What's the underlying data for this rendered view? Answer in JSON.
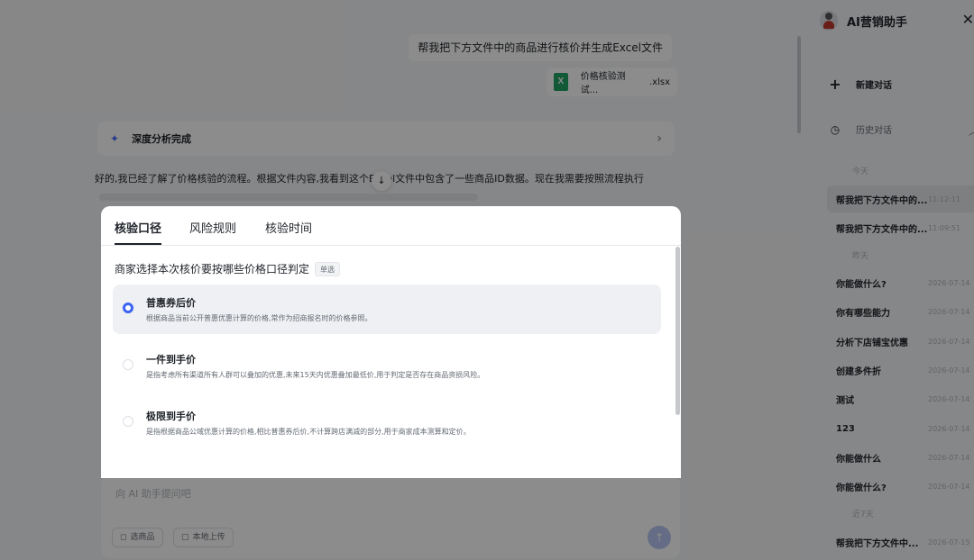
{
  "chat": {
    "user_message": "帮我把下方文件中的商品进行核价并生成Excel文件",
    "attachment": {
      "name": "价格核验测试...",
      "ext": ".xlsx",
      "icon": "excel-file-icon"
    },
    "analysis_card": {
      "title": "深度分析完成"
    },
    "ai_reply": "好的,我已经了解了价格核验的流程。根据文件内容,我看到这个Excel文件中包含了一些商品ID数据。现在我需要按照流程执行:",
    "input": {
      "placeholder": "向 AI 助手提问吧",
      "chips": [
        {
          "label": "选商品"
        },
        {
          "label": "本地上传"
        }
      ]
    }
  },
  "sidebar": {
    "title": "AI营销助手",
    "new_chat": "新建对话",
    "history": "历史对话",
    "groups": {
      "g1": "今天",
      "g2": "昨天",
      "g3": "近7天"
    },
    "items": [
      {
        "label": "帮我把下方文件中的...",
        "time": "11:12:11"
      },
      {
        "label": "帮我把下方文件中的...",
        "time": "11:09:51"
      },
      {
        "label": "你能做什么?",
        "time": "2026-07-14"
      },
      {
        "label": "你有哪些能力",
        "time": "2026-07-14"
      },
      {
        "label": "分析下店铺宝优惠",
        "time": "2026-07-14"
      },
      {
        "label": "创建多件折",
        "time": "2026-07-14"
      },
      {
        "label": "测试",
        "time": "2026-07-14"
      },
      {
        "label": "123",
        "time": "2026-07-14"
      },
      {
        "label": "你能做什么",
        "time": "2026-07-14"
      },
      {
        "label": "你能做什么?",
        "time": "2026-07-14"
      },
      {
        "label": "帮我把下方文件中...",
        "time": "2026-07-15"
      }
    ]
  },
  "modal": {
    "tabs": [
      {
        "label": "核验口径"
      },
      {
        "label": "风险规则"
      },
      {
        "label": "核验时间"
      }
    ],
    "question": "商家选择本次核价要按哪些价格口径判定",
    "badge": "单选",
    "options": [
      {
        "title": "普惠券后价",
        "desc": "根据商品当前公开普惠优惠计算的价格,常作为招商报名时的价格参照。",
        "selected": true
      },
      {
        "title": "一件到手价",
        "desc": "是指考虑所有渠道所有人群可以叠加的优惠,未来15天内优惠叠加最低价,用于判定是否存在商品资损风险。",
        "selected": false
      },
      {
        "title": "极限到手价",
        "desc": "是指根据商品公域优惠计算的价格,相比普惠券后价,不计算跨店满减的部分,用于商家成本测算和定价。",
        "selected": false
      }
    ]
  },
  "colors": {
    "accent": "#3d63f2",
    "excel": "#21a366"
  }
}
